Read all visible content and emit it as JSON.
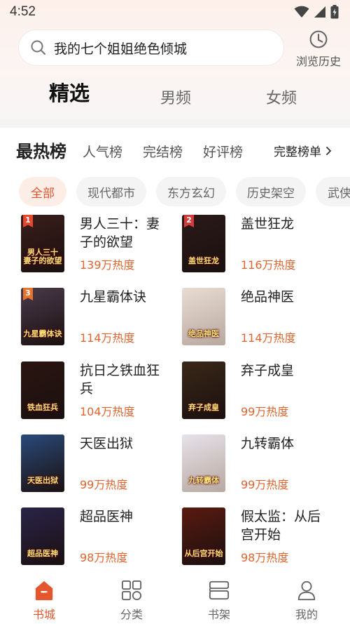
{
  "status_bar": {
    "time": "4:52"
  },
  "search": {
    "query": "我的七个姐姐绝色倾城"
  },
  "history": {
    "label": "浏览历史"
  },
  "channels": [
    {
      "label": "精选",
      "active": true
    },
    {
      "label": "男频",
      "active": false
    },
    {
      "label": "女频",
      "active": false
    }
  ],
  "ranks": {
    "tabs": [
      {
        "label": "最热榜",
        "active": true
      },
      {
        "label": "人气榜",
        "active": false
      },
      {
        "label": "完结榜",
        "active": false
      },
      {
        "label": "好评榜",
        "active": false
      }
    ],
    "full_list": "完整榜单"
  },
  "categories": [
    {
      "label": "全部",
      "active": true
    },
    {
      "label": "现代都市",
      "active": false
    },
    {
      "label": "东方玄幻",
      "active": false
    },
    {
      "label": "历史架空",
      "active": false
    },
    {
      "label": "武侠",
      "active": false
    }
  ],
  "books": [
    {
      "rank": "1",
      "title": "男人三十：妻子的欲望",
      "heat": "139万热度",
      "cover_text": "男人三十 妻子的欲望",
      "cover_color": "#3a1e1a"
    },
    {
      "rank": "2",
      "title": "盖世狂龙",
      "heat": "116万热度",
      "cover_text": "盖世狂龙",
      "cover_color": "#2a1a18"
    },
    {
      "rank": "3",
      "title": "九星霸体诀",
      "heat": "114万热度",
      "cover_text": "九星霸体诀",
      "cover_color": "#4a3a4a"
    },
    {
      "rank": "",
      "title": "绝品神医",
      "heat": "114万热度",
      "cover_text": "绝品神医",
      "cover_color": "#e8dcd2"
    },
    {
      "rank": "",
      "title": "抗日之铁血狂兵",
      "heat": "104万热度",
      "cover_text": "铁血狂兵",
      "cover_color": "#2a1510"
    },
    {
      "rank": "",
      "title": "弃子成皇",
      "heat": "99万热度",
      "cover_text": "弃子成皇",
      "cover_color": "#3a2818"
    },
    {
      "rank": "",
      "title": "天医出狱",
      "heat": "99万热度",
      "cover_text": "天医出狱",
      "cover_color": "#2a4a7a"
    },
    {
      "rank": "",
      "title": "九转霸体",
      "heat": "99万热度",
      "cover_text": "九转霸体",
      "cover_color": "#e6e2ea"
    },
    {
      "rank": "",
      "title": "超品医神",
      "heat": "98万热度",
      "cover_text": "超品医神",
      "cover_color": "#2a2448"
    },
    {
      "rank": "",
      "title": "假太监：从后宫开始",
      "heat": "98万热度",
      "cover_text": "从后宫开始",
      "cover_color": "#5a1a10"
    }
  ],
  "bottom_nav": [
    {
      "label": "书城",
      "icon": "bookstore-icon",
      "active": true
    },
    {
      "label": "分类",
      "icon": "category-icon",
      "active": false
    },
    {
      "label": "书架",
      "icon": "bookshelf-icon",
      "active": false
    },
    {
      "label": "我的",
      "icon": "profile-icon",
      "active": false
    }
  ],
  "colors": {
    "accent": "#e4572e",
    "heat": "#e06531",
    "chip_bg": "#f4f4f4",
    "chip_active_bg": "#fcede6"
  }
}
